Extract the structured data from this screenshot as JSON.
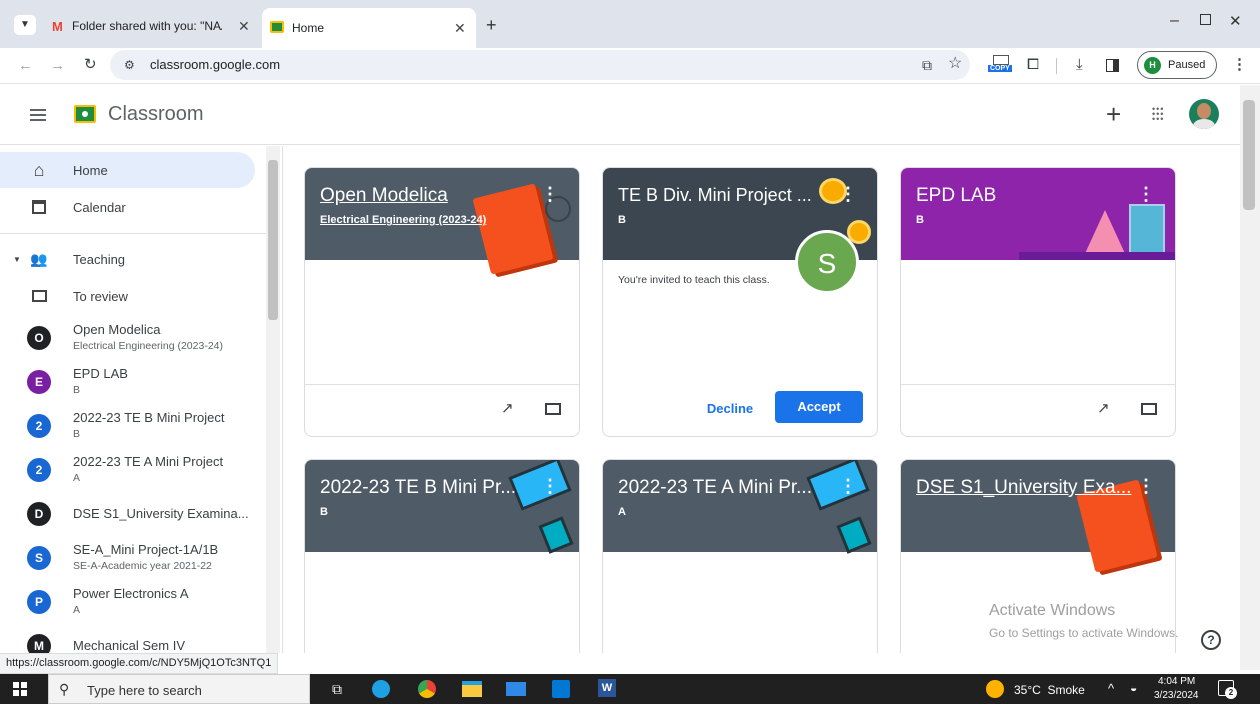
{
  "browser": {
    "tabs": [
      {
        "title": "Folder shared with you: \"NAAC",
        "favicon": "gmail-icon",
        "active": false
      },
      {
        "title": "Home",
        "favicon": "classroom-icon",
        "active": true
      }
    ],
    "url": "classroom.google.com",
    "profile_initial": "H",
    "profile_status": "Paused",
    "copy_badge": "COPY"
  },
  "app": {
    "name": "Classroom"
  },
  "sidebar": {
    "home": "Home",
    "calendar": "Calendar",
    "teaching": "Teaching",
    "to_review": "To review",
    "classes": [
      {
        "initial": "O",
        "name": "Open Modelica",
        "sub": "Electrical Engineering (2023-24)",
        "color": "#202124"
      },
      {
        "initial": "E",
        "name": "EPD LAB",
        "sub": "B",
        "color": "#7b1fa2"
      },
      {
        "initial": "2",
        "name": "2022-23 TE B Mini Project",
        "sub": "B",
        "color": "#1967d2"
      },
      {
        "initial": "2",
        "name": "2022-23 TE A Mini Project",
        "sub": "A",
        "color": "#1967d2"
      },
      {
        "initial": "D",
        "name": "DSE S1_University Examina...",
        "sub": "",
        "color": "#202124"
      },
      {
        "initial": "S",
        "name": "SE-A_Mini Project-1A/1B",
        "sub": "SE-A-Academic year 2021-22",
        "color": "#1967d2"
      },
      {
        "initial": "P",
        "name": "Power Electronics A",
        "sub": "A",
        "color": "#1967d2"
      },
      {
        "initial": "M",
        "name": "Mechanical Sem IV",
        "sub": "",
        "color": "#202124"
      }
    ]
  },
  "cards": [
    {
      "title": "Open Modelica",
      "sub": "Electrical Engineering (2023-24)",
      "color": "#4f5b66"
    },
    {
      "title": "TE B Div. Mini Project ...",
      "sub": "B",
      "color": "#3b4650",
      "invite": "You're invited to teach this class.",
      "decline": "Decline",
      "accept": "Accept",
      "avatar": "S"
    },
    {
      "title": "EPD LAB",
      "sub": "B",
      "color": "#8e24aa"
    },
    {
      "title": "2022-23 TE B Mini Pr...",
      "sub": "B",
      "color": "#4f5b66"
    },
    {
      "title": "2022-23 TE A Mini Pr...",
      "sub": "A",
      "color": "#4f5b66"
    },
    {
      "title": "DSE S1_University Exa...",
      "sub": "",
      "color": "#4f5b66"
    }
  ],
  "watermark": {
    "line1": "Activate Windows",
    "line2": "Go to Settings to activate Windows."
  },
  "status_link": "https://classroom.google.com/c/NDY5MjQ1OTc3NTQ1",
  "taskbar": {
    "search_placeholder": "Type here to search",
    "weather": "35°C  Smoke",
    "time": "4:04 PM",
    "date": "3/23/2024",
    "notif_count": "2"
  }
}
